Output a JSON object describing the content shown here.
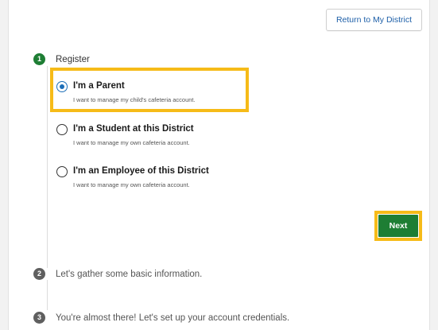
{
  "header": {
    "return_label": "Return to My District"
  },
  "steps": [
    {
      "number": "1",
      "label": "Register"
    },
    {
      "number": "2",
      "label": "Let's gather some basic information."
    },
    {
      "number": "3",
      "label": "You're almost there! Let's set up your account credentials."
    }
  ],
  "options": [
    {
      "title": "I'm a Parent",
      "description": "I want to manage my child's cafeteria account.",
      "selected": true
    },
    {
      "title": "I'm a Student at this District",
      "description": "I want to manage my own cafeteria account.",
      "selected": false
    },
    {
      "title": "I'm an Employee of this District",
      "description": "I want to manage my own cafeteria account.",
      "selected": false
    }
  ],
  "actions": {
    "next_label": "Next"
  },
  "colors": {
    "accent_green": "#1e7e34",
    "highlight_yellow": "#f6bb18",
    "link_blue": "#1d5fa8",
    "radio_blue": "#1d6fb8"
  }
}
